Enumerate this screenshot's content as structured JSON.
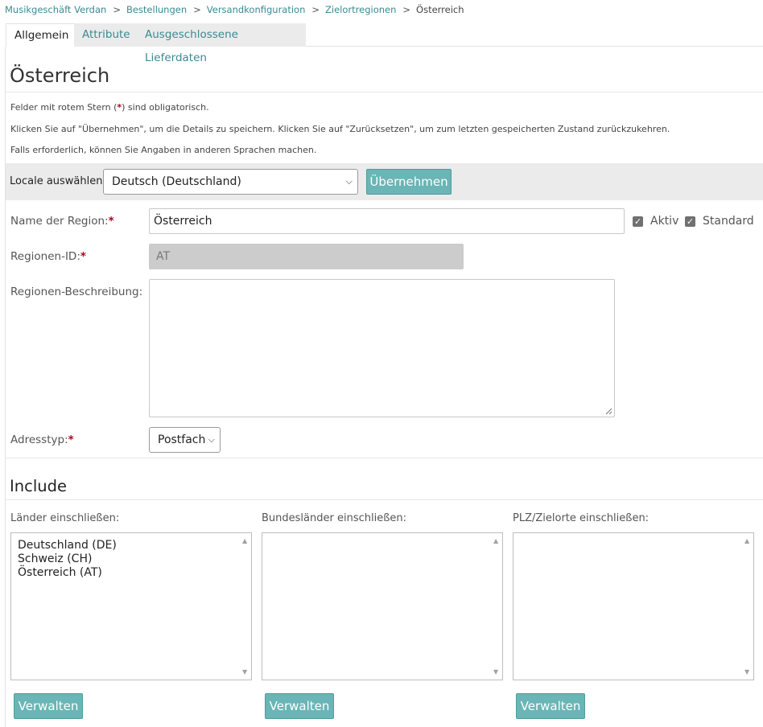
{
  "breadcrumb": {
    "items": [
      "Musikgeschäft Verdan",
      "Bestellungen",
      "Versandkonfiguration",
      "Zielortregionen"
    ],
    "current": "Österreich",
    "separator": ">"
  },
  "tabs": [
    {
      "label": "Allgemein",
      "active": true
    },
    {
      "label": "Attribute",
      "active": false
    },
    {
      "label": "Ausgeschlossene Lieferdaten",
      "active": false
    }
  ],
  "page": {
    "title": "Österreich",
    "info_required_pre": "Felder mit rotem Stern (",
    "info_required_star": "*",
    "info_required_post": ") sind obligatorisch.",
    "info_apply": "Klicken Sie auf \"Übernehmen\", um die Details zu speichern. Klicken Sie auf \"Zurücksetzen\", um zum letzten gespeicherten Zustand zurückzukehren.",
    "info_languages": "Falls erforderlich, können Sie Angaben in anderen Sprachen machen."
  },
  "locale": {
    "label": "Locale auswählen:",
    "selected": "Deutsch (Deutschland)",
    "apply_label": "Übernehmen"
  },
  "form": {
    "star": "*",
    "region_name": {
      "label": "Name der Region:",
      "value": "Österreich"
    },
    "aktiv": {
      "label": "Aktiv",
      "checked": true
    },
    "standard": {
      "label": "Standard",
      "checked": true
    },
    "region_id": {
      "label": "Regionen-ID:",
      "value": "AT"
    },
    "description": {
      "label": "Regionen-Beschreibung:",
      "value": ""
    },
    "address_type": {
      "label": "Adresstyp:",
      "selected": "Postfach"
    }
  },
  "include": {
    "title": "Include",
    "countries": {
      "label": "Länder einschließen:",
      "items": [
        "Deutschland (DE)",
        "Schweiz (CH)",
        "Österreich (AT)"
      ],
      "button": "Verwalten"
    },
    "states": {
      "label": "Bundesländer einschließen:",
      "items": [],
      "button": "Verwalten"
    },
    "zips": {
      "label": "PLZ/Zielorte einschließen:",
      "items": [],
      "button": "Verwalten"
    }
  },
  "icons": {
    "check": "check-icon",
    "chevron": "chevron-down-icon",
    "scroll_up": "scroll-up-arrow-icon",
    "scroll_down": "scroll-down-arrow-icon"
  },
  "colors": {
    "accent": "#6ab5b5",
    "link": "#3a8a92",
    "required": "#b0001e",
    "bar": "#ebebeb"
  }
}
